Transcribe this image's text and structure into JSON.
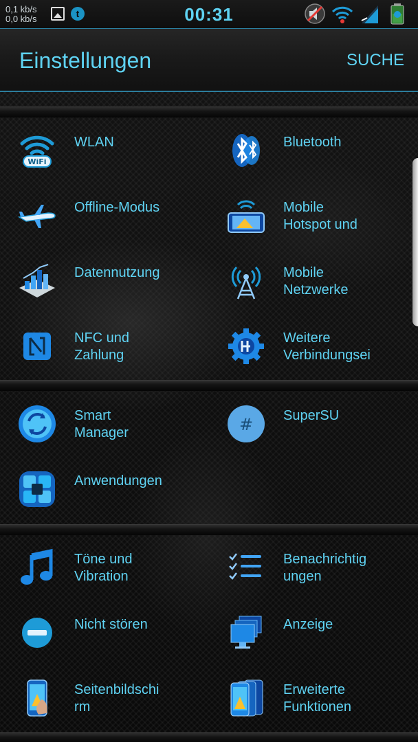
{
  "status_bar": {
    "net_up": "0,1 kb/s",
    "net_down": "0,0 kb/s",
    "time": "00:31",
    "icons": [
      "image-notification-icon",
      "t-app-icon",
      "mute-icon",
      "wifi-icon",
      "signal-icon",
      "battery-icon"
    ]
  },
  "header": {
    "title": "Einstellungen",
    "search": "SUCHE"
  },
  "sections": [
    {
      "items": [
        {
          "label": "WLAN",
          "icon": "wifi-icon"
        },
        {
          "label": "Bluetooth",
          "icon": "bluetooth-icon"
        },
        {
          "label": "Offline-Modus",
          "icon": "airplane-icon"
        },
        {
          "label": "Mobile\nHotspot und",
          "icon": "hotspot-icon"
        },
        {
          "label": "Datennutzung",
          "icon": "data-usage-icon"
        },
        {
          "label": "Mobile\nNetzwerke",
          "icon": "antenna-icon"
        },
        {
          "label": "NFC und\nZahlung",
          "icon": "nfc-icon"
        },
        {
          "label": "Weitere\nVerbindungsei",
          "icon": "gear-icon"
        }
      ]
    },
    {
      "items": [
        {
          "label": "Smart\nManager",
          "icon": "smart-manager-icon"
        },
        {
          "label": "SuperSU",
          "icon": "supersu-icon"
        },
        {
          "label": "Anwendungen",
          "icon": "apps-icon"
        }
      ]
    },
    {
      "items": [
        {
          "label": "Töne und\nVibration",
          "icon": "music-note-icon"
        },
        {
          "label": "Benachrichtig\nungen",
          "icon": "notifications-list-icon"
        },
        {
          "label": "Nicht stören",
          "icon": "do-not-disturb-icon"
        },
        {
          "label": "Anzeige",
          "icon": "display-icon"
        },
        {
          "label": "Seitenbildschi\nrm",
          "icon": "edge-screen-icon"
        },
        {
          "label": "Erweiterte\nFunktionen",
          "icon": "advanced-features-icon"
        }
      ]
    }
  ],
  "colors": {
    "accent": "#5fd3f3",
    "icon_blue": "#1e9bd7",
    "background": "#0b0b0b"
  }
}
